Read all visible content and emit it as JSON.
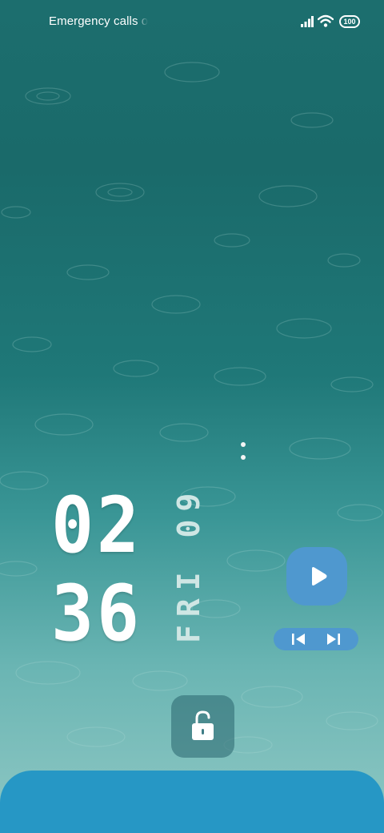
{
  "status_bar": {
    "carrier_text": "Emergency calls only",
    "battery_level": "100",
    "icons": [
      "signal-icon",
      "wifi-icon",
      "battery-icon"
    ]
  },
  "clock": {
    "hours": "02",
    "minutes": "36",
    "date": "FRI 09"
  },
  "media": {
    "icons": [
      "play-icon",
      "previous-track-icon",
      "next-track-icon"
    ],
    "accent_color": "#4f98cf"
  },
  "lock": {
    "icon": "unlock-icon"
  },
  "colors": {
    "wallpaper_top": "#1c6e6e",
    "wallpaper_bottom": "#8fc8c4",
    "bottom_sheet": "#2697c5"
  }
}
